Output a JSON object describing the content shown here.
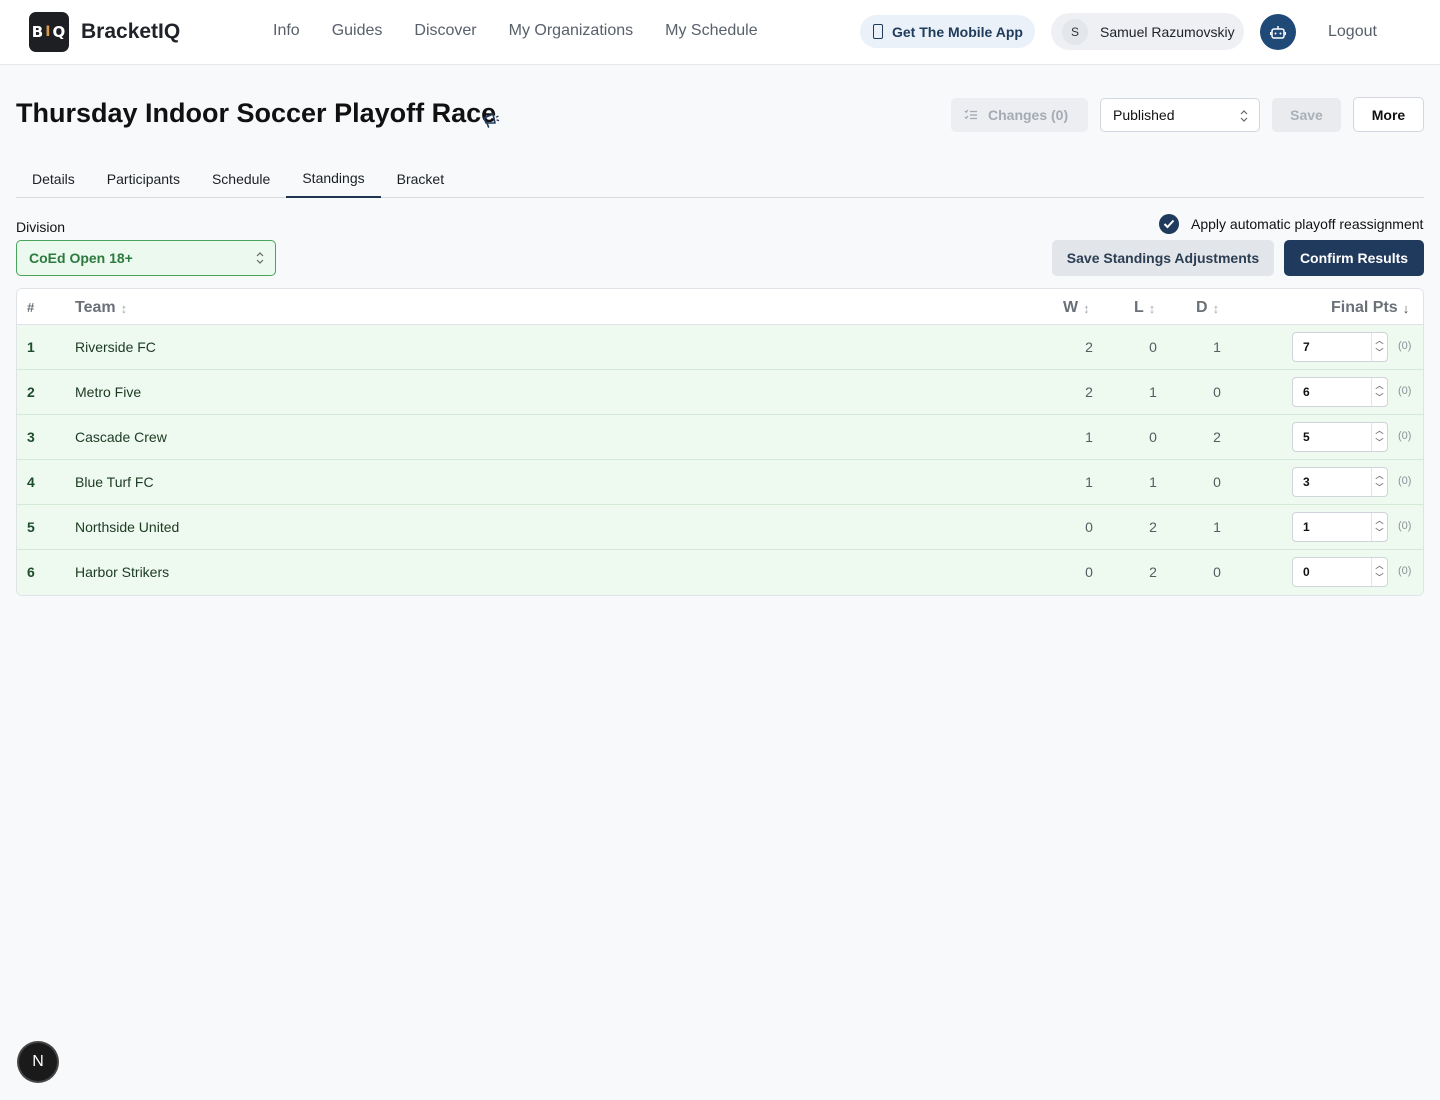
{
  "header": {
    "logo_left": "B",
    "logo_mid": "I",
    "logo_right": "Q",
    "brand": "BracketIQ",
    "nav": [
      "Info",
      "Guides",
      "Discover",
      "My Organizations",
      "My Schedule"
    ],
    "mobile_app": "Get The Mobile App",
    "user_initial": "S",
    "user_name": "Samuel Razumovskiy",
    "logout": "Logout"
  },
  "page": {
    "title": "Thursday Indoor Soccer Playoff Race",
    "changes": "Changes (0)",
    "status": "Published",
    "save": "Save",
    "more": "More"
  },
  "tabs": [
    {
      "label": "Details",
      "active": false
    },
    {
      "label": "Participants",
      "active": false
    },
    {
      "label": "Schedule",
      "active": false
    },
    {
      "label": "Standings",
      "active": true
    },
    {
      "label": "Bracket",
      "active": false
    }
  ],
  "controls": {
    "division_label": "Division",
    "division_value": "CoEd Open 18+",
    "auto_reassign": "Apply automatic playoff reassignment",
    "auto_reassign_checked": true,
    "save_adjustments": "Save Standings Adjustments",
    "confirm": "Confirm Results"
  },
  "table": {
    "headers": {
      "rank": "#",
      "team": "Team",
      "w": "W",
      "l": "L",
      "d": "D",
      "pts": "Final Pts"
    },
    "rows": [
      {
        "rank": "1",
        "team": "Riverside FC",
        "w": "2",
        "l": "0",
        "d": "1",
        "pts": "7",
        "adj": "(0)"
      },
      {
        "rank": "2",
        "team": "Metro Five",
        "w": "2",
        "l": "1",
        "d": "0",
        "pts": "6",
        "adj": "(0)"
      },
      {
        "rank": "3",
        "team": "Cascade Crew",
        "w": "1",
        "l": "0",
        "d": "2",
        "pts": "5",
        "adj": "(0)"
      },
      {
        "rank": "4",
        "team": "Blue Turf FC",
        "w": "1",
        "l": "1",
        "d": "0",
        "pts": "3",
        "adj": "(0)"
      },
      {
        "rank": "5",
        "team": "Northside United",
        "w": "0",
        "l": "2",
        "d": "1",
        "pts": "1",
        "adj": "(0)"
      },
      {
        "rank": "6",
        "team": "Harbor Strikers",
        "w": "0",
        "l": "2",
        "d": "0",
        "pts": "0",
        "adj": "(0)"
      }
    ]
  },
  "dev_badge": "N",
  "colors": {
    "primary": "#1f3a5c",
    "row_bg": "#eef9ef",
    "division_green": "#2c7a3e"
  }
}
